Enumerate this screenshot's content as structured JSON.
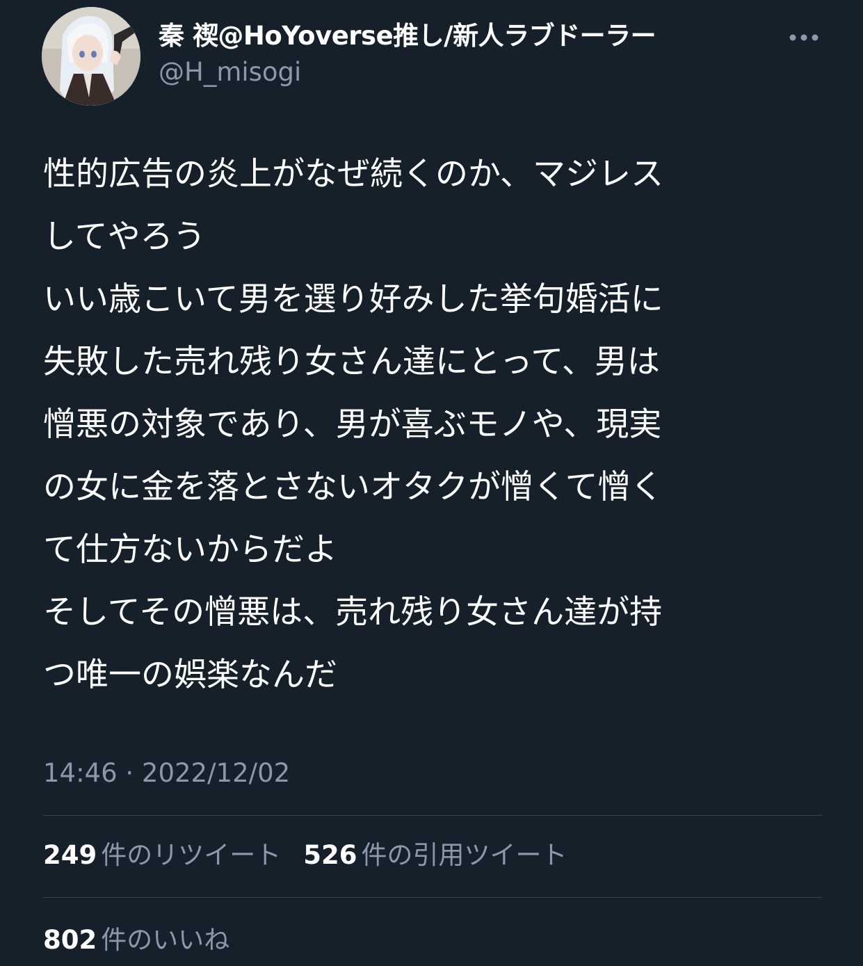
{
  "author": {
    "display_name": "秦 禊@HoYoverse推し/新人ラブドーラー",
    "handle": "@H_misogi",
    "avatar_icon": "user-avatar"
  },
  "tweet": {
    "lines": [
      "性的広告の炎上がなぜ続くのか、マジレス",
      "してやろう",
      "いい歳こいて男を選り好みした挙句婚活に",
      "失敗した売れ残り女さん達にとって、男は",
      "憎悪の対象であり、男が喜ぶモノや、現実",
      "の女に金を落とさないオタクが憎くて憎く",
      "て仕方ないからだよ",
      "そしてその憎悪は、売れ残り女さん達が持",
      "つ唯一の娯楽なんだ"
    ],
    "timestamp": "14:46 · 2022/12/02"
  },
  "stats": {
    "retweets": {
      "count": "249",
      "label": "件のリツイート"
    },
    "quotes": {
      "count": "526",
      "label": "件の引用ツイート"
    },
    "likes": {
      "count": "802",
      "label": "件のいいね"
    }
  },
  "colors": {
    "background": "#15202b",
    "primary_text": "#ffffff",
    "secondary_text": "#8b98a5",
    "divider": "#38444d"
  },
  "icons": {
    "more": "more-horizontal-icon"
  }
}
